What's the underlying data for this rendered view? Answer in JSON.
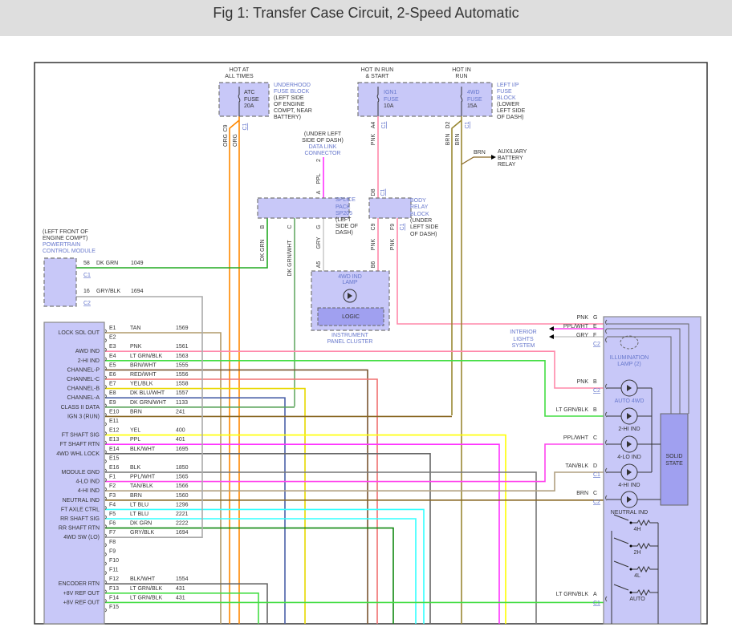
{
  "title": "Fig 1: Transfer Case Circuit, 2-Speed Automatic",
  "fuses": {
    "atc": {
      "hot": [
        "HOT AT",
        "ALL TIMES"
      ],
      "label": [
        "ATC",
        "FUSE",
        "20A"
      ],
      "location": [
        "UNDERHOOD",
        "FUSE BLOCK"
      ],
      "note": [
        "(LEFT SIDE",
        "OF ENGINE",
        "COMPT, NEAR",
        "BATTERY)"
      ],
      "pin": "C9",
      "conn": "C1",
      "wires": [
        "ORG",
        "ORG"
      ]
    },
    "ign1": {
      "hot": [
        "HOT IN RUN",
        "& START"
      ],
      "label": [
        "IGN1",
        "FUSE",
        "10A"
      ],
      "pin": "A4",
      "conn": "C1",
      "wire": "PNK"
    },
    "fwd": {
      "hot": [
        "HOT IN",
        "RUN"
      ],
      "label": [
        "4WD",
        "FUSE",
        "15A"
      ],
      "pin": "D2",
      "conn": "C1",
      "wires": [
        "BRN",
        "BRN"
      ]
    },
    "ip_block": {
      "location": [
        "LEFT I/P",
        "FUSE",
        "BLOCK"
      ],
      "note": [
        "(LOWER",
        "LEFT SIDE",
        "OF DASH)"
      ]
    }
  },
  "dlc": {
    "note": [
      "(UNDER LEFT",
      "SIDE OF DASH)"
    ],
    "label": [
      "DATA LINK",
      "CONNECTOR"
    ],
    "pin": "2",
    "wire": "PPL"
  },
  "aux_relay": {
    "wire": "BRN",
    "label": [
      "AUXILIARY",
      "BATTERY",
      "RELAY"
    ]
  },
  "splice": {
    "label": [
      "SPLICE",
      "PACK",
      "SP205"
    ],
    "note": [
      "(LEFT",
      "SIDE OF",
      "DASH)"
    ],
    "pins": [
      "A",
      "B",
      "C",
      "G"
    ],
    "wires": [
      "DK GRN",
      "DK GRN/WHT",
      "GRY"
    ]
  },
  "body_relay": {
    "label": [
      "BODY",
      "RELAY",
      "BLOCK"
    ],
    "note": [
      "(UNDER",
      "LEFT SIDE",
      "OF DASH)"
    ],
    "pins": [
      "D8",
      "C1",
      "C9",
      "F9",
      "C1"
    ],
    "wires": [
      "PNK",
      "PNK"
    ]
  },
  "cluster": {
    "lamp": [
      "4WD IND",
      "LAMP"
    ],
    "logic": "LOGIC",
    "label": [
      "INSTRUMENT",
      "PANEL CLUSTER"
    ],
    "pins": [
      "A5",
      "B6"
    ]
  },
  "pcm": {
    "note": [
      "(LEFT FRONT OF",
      "ENGINE COMPT)"
    ],
    "label": [
      "POWERTRAIN",
      "CONTROL MODULE"
    ],
    "c1": {
      "pin": "58",
      "color": "DK GRN",
      "circuit": "1049",
      "conn": "C1"
    },
    "c2": {
      "pin": "16",
      "color": "GRY/BLK",
      "circuit": "1694",
      "conn": "C2"
    }
  },
  "module_pins": [
    {
      "pin": "E1",
      "function": "LOCK SOL OUT",
      "color": "TAN",
      "circuit": "1569",
      "hex": "#b09a6a"
    },
    {
      "pin": "E2",
      "function": "",
      "color": "",
      "circuit": ""
    },
    {
      "pin": "E3",
      "function": "AWD IND",
      "color": "PNK",
      "circuit": "1561",
      "hex": "#ff88aa"
    },
    {
      "pin": "E4",
      "function": "2-HI IND",
      "color": "LT GRN/BLK",
      "circuit": "1563",
      "hex": "#44dd44"
    },
    {
      "pin": "E5",
      "function": "CHANNEL-P",
      "color": "BRN/WHT",
      "circuit": "1555",
      "hex": "#7a5530"
    },
    {
      "pin": "E6",
      "function": "CHANNEL-C",
      "color": "RED/WHT",
      "circuit": "1556",
      "hex": "#f07070"
    },
    {
      "pin": "E7",
      "function": "CHANNEL-B",
      "color": "YEL/BLK",
      "circuit": "1558",
      "hex": "#e8d800"
    },
    {
      "pin": "E8",
      "function": "CHANNEL-A",
      "color": "DK BLU/WHT",
      "circuit": "1557",
      "hex": "#4a60a8"
    },
    {
      "pin": "E9",
      "function": "CLASS II DATA",
      "color": "DK GRN/WHT",
      "circuit": "1133",
      "hex": "#55a055"
    },
    {
      "pin": "E10",
      "function": "IGN 3 (RUN)",
      "color": "BRN",
      "circuit": "241",
      "hex": "#886622"
    },
    {
      "pin": "E11",
      "function": "",
      "color": "",
      "circuit": ""
    },
    {
      "pin": "E12",
      "function": "FT SHAFT SIG",
      "color": "YEL",
      "circuit": "400",
      "hex": "#ffff00"
    },
    {
      "pin": "E13",
      "function": "FT SHAFT RTN",
      "color": "PPL",
      "circuit": "401",
      "hex": "#ff33ff"
    },
    {
      "pin": "E14",
      "function": "4WD WHL LOCK",
      "color": "BLK/WHT",
      "circuit": "1695",
      "hex": "#666666"
    },
    {
      "pin": "E15",
      "function": "",
      "color": "",
      "circuit": ""
    },
    {
      "pin": "E16",
      "function": "MODULE GND",
      "color": "BLK",
      "circuit": "1850",
      "hex": "#777777"
    },
    {
      "pin": "F1",
      "function": "4-LO IND",
      "color": "PPL/WHT",
      "circuit": "1565",
      "hex": "#ff44ee"
    },
    {
      "pin": "F2",
      "function": "4-HI IND",
      "color": "TAN/BLK",
      "circuit": "1566",
      "hex": "#b0a080"
    },
    {
      "pin": "F3",
      "function": "NEUTRAL IND",
      "color": "BRN",
      "circuit": "1560",
      "hex": "#886622"
    },
    {
      "pin": "F4",
      "function": "FT AXLE CTRL",
      "color": "LT BLU",
      "circuit": "1296",
      "hex": "#33ffff"
    },
    {
      "pin": "F5",
      "function": "RR SHAFT SIG",
      "color": "LT BLU",
      "circuit": "2221",
      "hex": "#33ffff"
    },
    {
      "pin": "F6",
      "function": "RR SHAFT RTN",
      "color": "DK GRN",
      "circuit": "2222",
      "hex": "#118811"
    },
    {
      "pin": "F7",
      "function": "4WD SW (LO)",
      "color": "GRY/BLK",
      "circuit": "1694",
      "hex": "#aaaaaa"
    },
    {
      "pin": "F8",
      "function": "",
      "color": "",
      "circuit": ""
    },
    {
      "pin": "F9",
      "function": "",
      "color": "",
      "circuit": ""
    },
    {
      "pin": "F10",
      "function": "",
      "color": "",
      "circuit": ""
    },
    {
      "pin": "F11",
      "function": "",
      "color": "",
      "circuit": ""
    },
    {
      "pin": "F12",
      "function": "ENCODER RTN",
      "color": "BLK/WHT",
      "circuit": "1554",
      "hex": "#666666"
    },
    {
      "pin": "F13",
      "function": "+8V REF OUT",
      "color": "LT GRN/BLK",
      "circuit": "431",
      "hex": "#44dd44"
    },
    {
      "pin": "F14",
      "function": "+8V REF OUT",
      "color": "LT GRN/BLK",
      "circuit": "431",
      "hex": "#44dd44"
    },
    {
      "pin": "F15",
      "function": "",
      "color": "",
      "circuit": ""
    }
  ],
  "switch_module": {
    "pins": [
      {
        "color": "PNK",
        "pin": "G"
      },
      {
        "color": "PPL/WHT",
        "pin": "E"
      },
      {
        "color": "GRY",
        "pin": "F",
        "conn": "C2"
      },
      {
        "color": "PNK",
        "pin": "B",
        "conn": "C2"
      },
      {
        "color": "LT GRN/BLK",
        "pin": "B"
      },
      {
        "color": "PPL/WHT",
        "pin": "C"
      },
      {
        "color": "TAN/BLK",
        "pin": "D",
        "conn": "C1"
      },
      {
        "color": "BRN",
        "pin": "C",
        "conn": "C2"
      },
      {
        "color": "LT GRN/BLK",
        "pin": "A",
        "conn": "C1"
      }
    ],
    "interior_lights": [
      "INTERIOR",
      "LIGHTS",
      "SYSTEM"
    ],
    "illumination": [
      "ILLUMINATION",
      "LAMP (2)"
    ],
    "indicators": [
      "AUTO 4WD",
      "2-HI IND",
      "4-LO IND",
      "4-HI IND",
      "NEUTRAL IND"
    ],
    "solid_state": [
      "SOLID",
      "STATE"
    ],
    "positions": [
      "4H",
      "2H",
      "4L",
      "AUTO"
    ]
  }
}
